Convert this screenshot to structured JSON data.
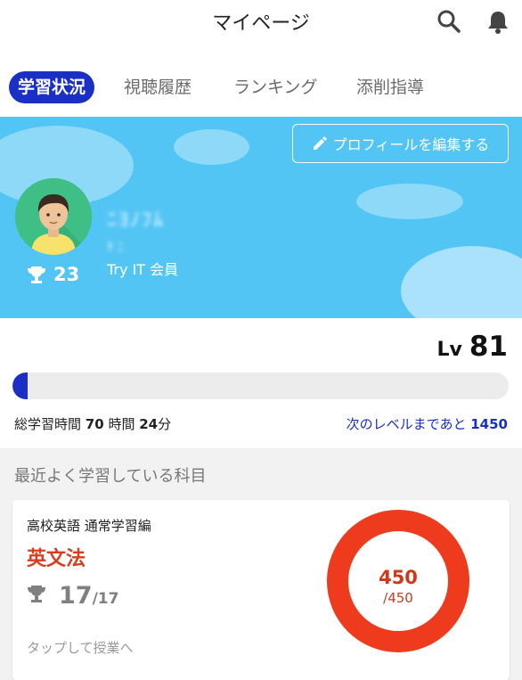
{
  "header": {
    "title": "マイページ",
    "search_icon": "search-icon",
    "bell_icon": "bell-icon"
  },
  "tabs": [
    {
      "label": "学習状況",
      "active": true
    },
    {
      "label": "視聴履歴",
      "active": false
    },
    {
      "label": "ランキング",
      "active": false
    },
    {
      "label": "添削指導",
      "active": false
    }
  ],
  "profile": {
    "edit_label": "プロフィールを編集する",
    "user_name": "ﾆﾖﾉﾌﾑ",
    "user_id": "ﾁ ﾆ",
    "member_label": "Try IT 会員",
    "trophy_count": "23",
    "banner_color": "#53c5f4"
  },
  "level": {
    "prefix": "Lv",
    "value": "81",
    "progress_fraction": 0.03,
    "study_time_label": "総学習時間",
    "study_hours": "70",
    "hours_unit": "時間",
    "study_minutes": "24",
    "minutes_unit": "分",
    "next_level_label": "次のレベルまであと",
    "next_level_points": "1450"
  },
  "recent": {
    "section_title": "最近よく学習している科目",
    "card": {
      "course": "高校英語 通常学習編",
      "subject": "英文法",
      "trophies": "17",
      "trophies_total": "/17",
      "tap_hint": "タップして授業へ",
      "donut_value": "450",
      "donut_total": "/450",
      "donut_color": "#ee3b1e"
    }
  }
}
